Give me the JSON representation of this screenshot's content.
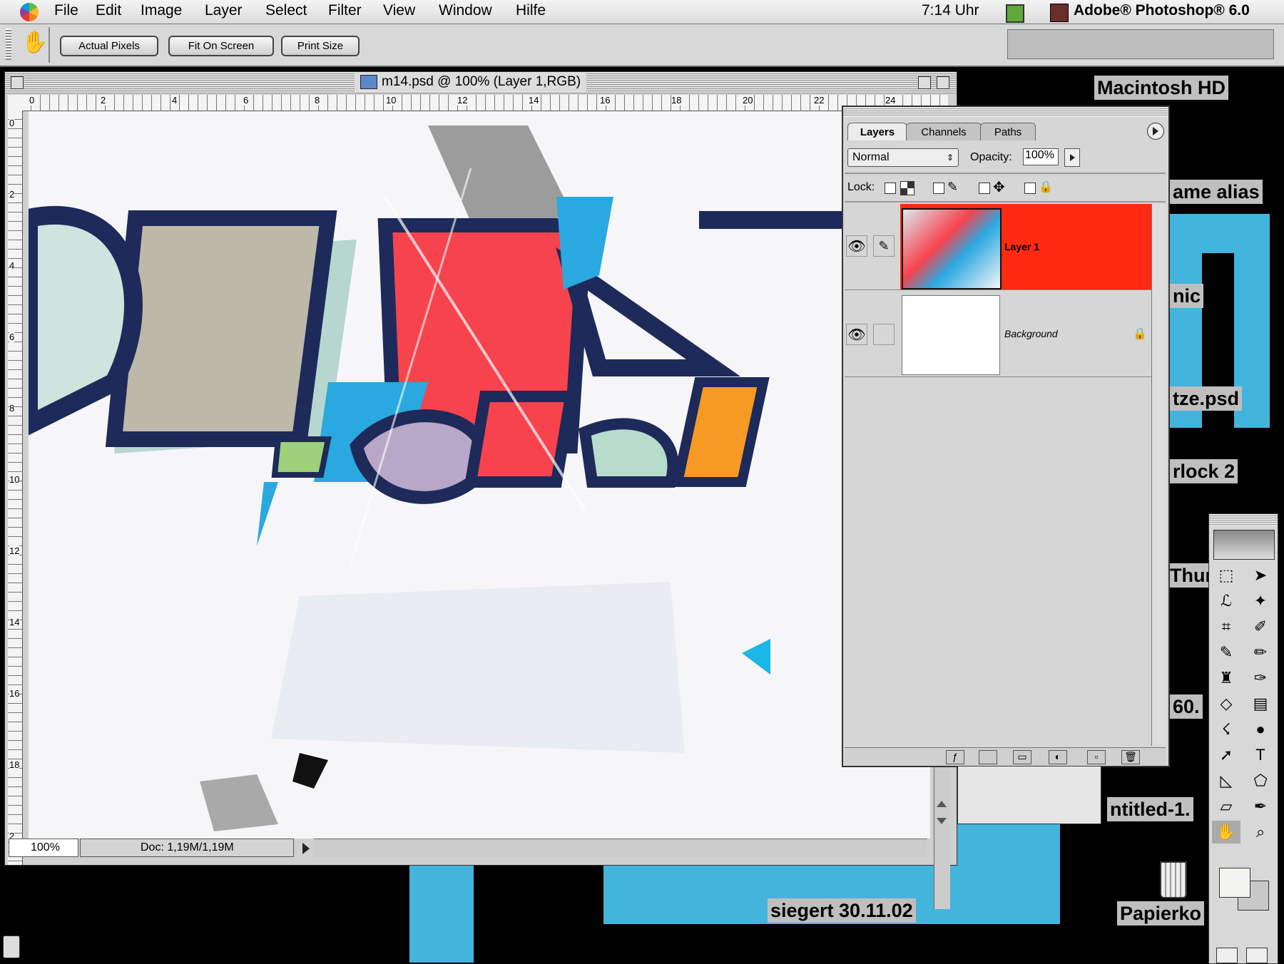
{
  "menubar": {
    "items": [
      "File",
      "Edit",
      "Image",
      "Layer",
      "Select",
      "Filter",
      "View",
      "Window",
      "Hilfe"
    ],
    "clock": "7:14 Uhr",
    "app_name": "Adobe® Photoshop® 6.0"
  },
  "options_bar": {
    "buttons": [
      "Actual Pixels",
      "Fit On Screen",
      "Print Size"
    ]
  },
  "document": {
    "title": "m14.psd @ 100% (Layer 1,RGB)",
    "ruler_h": [
      "0",
      "2",
      "4",
      "6",
      "8",
      "10",
      "12",
      "14",
      "16",
      "18",
      "20",
      "22",
      "24"
    ],
    "ruler_v": [
      "0",
      "2",
      "4",
      "6",
      "8",
      "10",
      "12",
      "14",
      "16",
      "18",
      "2"
    ],
    "zoom": "100%",
    "doc_size": "Doc: 1,19M/1,19M"
  },
  "layers_panel": {
    "tabs": [
      "Layers",
      "Channels",
      "Paths"
    ],
    "blend_mode": "Normal",
    "opacity_label": "Opacity:",
    "opacity_value": "100%",
    "lock_label": "Lock:",
    "layers": [
      {
        "name": "Layer 1",
        "selected": true
      },
      {
        "name": "Background",
        "selected": false
      }
    ]
  },
  "desktop": {
    "icons": [
      "Macintosh HD",
      "ame alias",
      "nic",
      "tze.psd",
      "rlock 2",
      "Thun",
      "60.",
      "ntitled-1.",
      "siegert 30.11.02",
      "Papierko"
    ]
  },
  "colors": {
    "desktop": "#000000",
    "desktop_accent": "#43b4dc",
    "selected_layer": "#ff2a10",
    "panel_bg": "#d6d6d6"
  }
}
